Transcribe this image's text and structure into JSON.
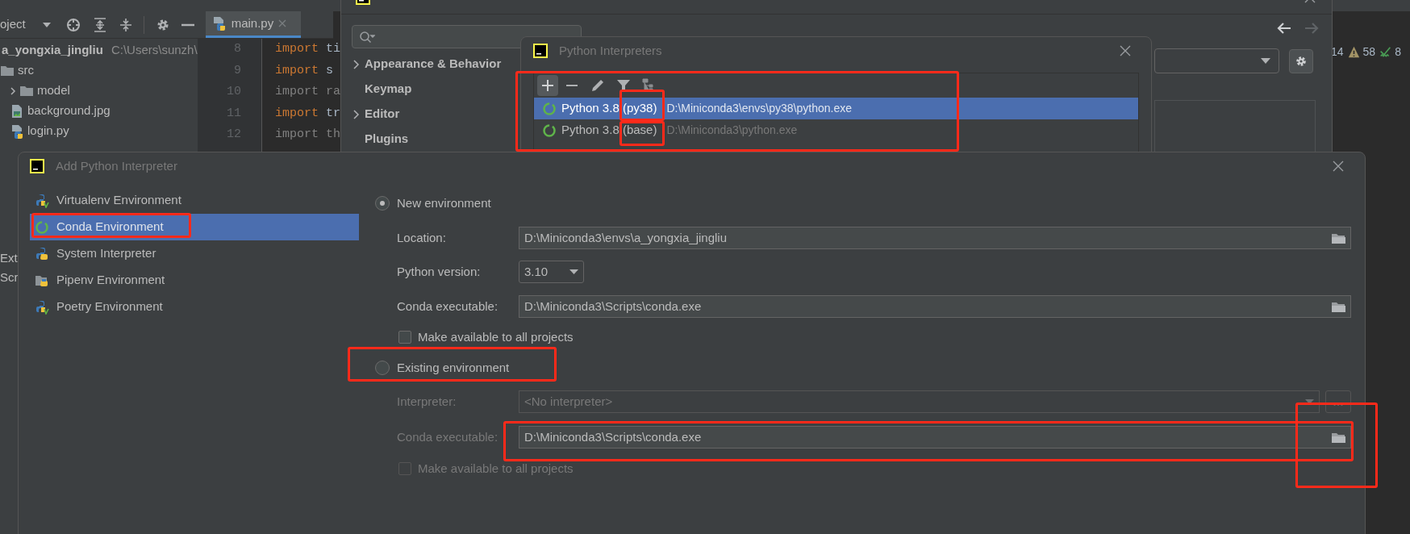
{
  "ide": {
    "project_view": "oject",
    "editor_tab": {
      "label": "main.py",
      "selected": true
    },
    "project_tree": [
      {
        "label": "a_yongxia_jingliu",
        "path": "C:\\Users\\sunzh\\",
        "kind": "project",
        "children": [
          {
            "label": "src",
            "kind": "folder",
            "children": [
              {
                "label": "model",
                "kind": "folder",
                "expanded": false
              },
              {
                "label": "background.jpg",
                "kind": "image"
              },
              {
                "label": "login.py",
                "kind": "python"
              }
            ]
          }
        ]
      }
    ],
    "left_fragments": [
      "Ext",
      "Scr"
    ],
    "code_lines": [
      {
        "number": "8",
        "keyword": "import",
        "rest": "ti",
        "dim": false
      },
      {
        "number": "9",
        "keyword": "import",
        "rest": "s",
        "dim": false
      },
      {
        "number": "10",
        "keyword": "import",
        "rest": "ra",
        "dim": true
      },
      {
        "number": "11",
        "keyword": "import",
        "rest": "tr",
        "dim": false
      },
      {
        "number": "12",
        "keyword": "import",
        "rest": "th",
        "dim": true
      }
    ],
    "inspections": [
      {
        "kind": "error",
        "count": "14"
      },
      {
        "kind": "warning",
        "count": "58"
      },
      {
        "kind": "typo",
        "count": "8"
      }
    ]
  },
  "settings": {
    "menu": [
      {
        "label": "Appearance & Behavior",
        "expandable": true
      },
      {
        "label": "Keymap",
        "expandable": false
      },
      {
        "label": "Editor",
        "expandable": true
      },
      {
        "label": "Plugins",
        "expandable": false
      }
    ]
  },
  "interpreters_dialog": {
    "title": "Python Interpreters",
    "rows": [
      {
        "name": "Python 3.8 (py38)",
        "path": "D:\\Miniconda3\\envs\\py38\\python.exe",
        "selected": true
      },
      {
        "name": "Python 3.8 (base)",
        "path": "D:\\Miniconda3\\python.exe",
        "selected": false
      }
    ]
  },
  "add_dialog": {
    "title": "Add Python Interpreter",
    "types": [
      {
        "label": "Virtualenv Environment",
        "kind": "virtualenv",
        "selected": false
      },
      {
        "label": "Conda Environment",
        "kind": "conda",
        "selected": true
      },
      {
        "label": "System Interpreter",
        "kind": "python",
        "selected": false
      },
      {
        "label": "Pipenv Environment",
        "kind": "pipenv",
        "selected": false
      },
      {
        "label": "Poetry Environment",
        "kind": "virtualenv",
        "selected": false
      }
    ],
    "new_environment": {
      "label": "New environment",
      "selected": true,
      "location": {
        "label": "Location:",
        "value": "D:\\Miniconda3\\envs\\a_yongxia_jingliu"
      },
      "python_version": {
        "label": "Python version:",
        "value": "3.10"
      },
      "conda_executable": {
        "label": "Conda executable:",
        "value": "D:\\Miniconda3\\Scripts\\conda.exe"
      },
      "make_available": {
        "label": "Make available to all projects",
        "checked": false
      }
    },
    "existing_environment": {
      "label": "Existing environment",
      "selected": false,
      "interpreter": {
        "label": "Interpreter:",
        "value": "<No interpreter>",
        "disabled": true
      },
      "conda_executable": {
        "label": "Conda executable:",
        "value": "D:\\Miniconda3\\Scripts\\conda.exe",
        "disabled": false
      },
      "make_available": {
        "label": "Make available to all projects",
        "checked": false
      }
    }
  }
}
